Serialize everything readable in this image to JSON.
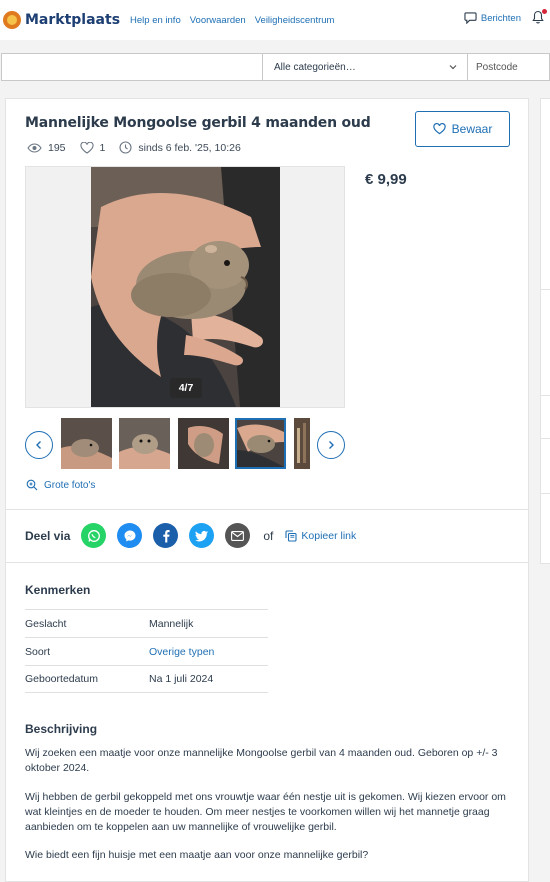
{
  "header": {
    "brand": "Marktplaats",
    "links": [
      "Help en info",
      "Voorwaarden",
      "Veiligheidscentrum"
    ],
    "messages_label": "Berichten"
  },
  "search": {
    "query": "",
    "category": "Alle categorieën…",
    "postcode_placeholder": "Postcode"
  },
  "listing": {
    "title": "Mannelijke Mongoolse gerbil 4 maanden oud",
    "views": "195",
    "favorites": "1",
    "since": "sinds 6 feb. '25, 10:26",
    "save_label": "Bewaar",
    "price": "€ 9,99",
    "photo_counter": "4/7",
    "big_photos_label": "Grote foto's"
  },
  "share": {
    "label": "Deel via",
    "networks": [
      "whatsapp",
      "messenger",
      "facebook",
      "twitter",
      "email"
    ],
    "or": "of",
    "copy_label": "Kopieer link"
  },
  "characteristics": {
    "title": "Kenmerken",
    "rows": [
      {
        "key": "Geslacht",
        "value": "Mannelijk"
      },
      {
        "key": "Soort",
        "value": "Overige typen"
      },
      {
        "key": "Geboortedatum",
        "value": "Na 1 juli 2024"
      }
    ]
  },
  "description": {
    "title": "Beschrijving",
    "paragraphs": [
      "Wij zoeken een maatje voor onze mannelijke Mongoolse gerbil van 4 maanden oud. Geboren op +/- 3 oktober 2024.",
      "Wij hebben de gerbil gekoppeld met ons vrouwtje waar één nestje uit is gekomen. Wij kiezen ervoor om wat kleintjes en de moeder te houden. Om meer nestjes te voorkomen willen wij het mannetje graag aanbieden om te koppelen aan uw mannelijke of vrouwelijke gerbil.",
      "Wie biedt een fijn huisje met een maatje aan voor onze mannelijke gerbil?"
    ]
  },
  "colors": {
    "brand_blue": "#1f6fb4",
    "text": "#2d3c4d",
    "whatsapp": "#25d366",
    "messenger": "#1e8cf0",
    "facebook": "#1b5faa",
    "twitter": "#1da1f2",
    "email": "#555555"
  }
}
